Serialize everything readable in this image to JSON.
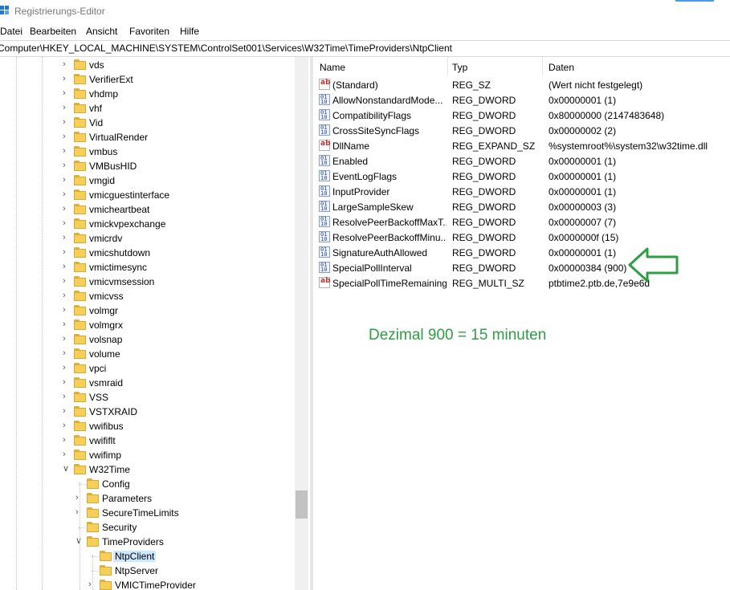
{
  "window": {
    "title": "Registrierungs-Editor"
  },
  "menu": [
    "Datei",
    "Bearbeiten",
    "Ansicht",
    "Favoriten",
    "Hilfe"
  ],
  "address": "Computer\\HKEY_LOCAL_MACHINE\\SYSTEM\\ControlSet001\\Services\\W32Time\\TimeProviders\\NtpClient",
  "tree": [
    {
      "label": "vds"
    },
    {
      "label": "VerifierExt"
    },
    {
      "label": "vhdmp"
    },
    {
      "label": "vhf"
    },
    {
      "label": "Vid"
    },
    {
      "label": "VirtualRender"
    },
    {
      "label": "vmbus"
    },
    {
      "label": "VMBusHID"
    },
    {
      "label": "vmgid"
    },
    {
      "label": "vmicguestinterface"
    },
    {
      "label": "vmicheartbeat"
    },
    {
      "label": "vmickvpexchange"
    },
    {
      "label": "vmicrdv"
    },
    {
      "label": "vmicshutdown"
    },
    {
      "label": "vmictimesync"
    },
    {
      "label": "vmicvmsession"
    },
    {
      "label": "vmicvss"
    },
    {
      "label": "volmgr"
    },
    {
      "label": "volmgrx"
    },
    {
      "label": "volsnap"
    },
    {
      "label": "volume"
    },
    {
      "label": "vpci"
    },
    {
      "label": "vsmraid"
    },
    {
      "label": "VSS"
    },
    {
      "label": "VSTXRAID"
    },
    {
      "label": "vwifibus"
    },
    {
      "label": "vwififlt"
    },
    {
      "label": "vwifimp"
    },
    {
      "label": "W32Time"
    },
    {
      "label": "Config"
    },
    {
      "label": "Parameters"
    },
    {
      "label": "SecureTimeLimits"
    },
    {
      "label": "Security"
    },
    {
      "label": "TimeProviders"
    },
    {
      "label": "NtpClient"
    },
    {
      "label": "NtpServer"
    },
    {
      "label": "VMICTimeProvider"
    }
  ],
  "list": {
    "headers": {
      "name": "Name",
      "type": "Typ",
      "data": "Daten"
    },
    "rows": [
      {
        "name": "(Standard)",
        "type": "REG_SZ",
        "data": "(Wert nicht festgelegt)",
        "icon": "string"
      },
      {
        "name": "AllowNonstandardMode...",
        "type": "REG_DWORD",
        "data": "0x00000001 (1)",
        "icon": "binary"
      },
      {
        "name": "CompatibilityFlags",
        "type": "REG_DWORD",
        "data": "0x80000000 (2147483648)",
        "icon": "binary"
      },
      {
        "name": "CrossSiteSyncFlags",
        "type": "REG_DWORD",
        "data": "0x00000002 (2)",
        "icon": "binary"
      },
      {
        "name": "DllName",
        "type": "REG_EXPAND_SZ",
        "data": "%systemroot%\\system32\\w32time.dll",
        "icon": "string"
      },
      {
        "name": "Enabled",
        "type": "REG_DWORD",
        "data": "0x00000001 (1)",
        "icon": "binary"
      },
      {
        "name": "EventLogFlags",
        "type": "REG_DWORD",
        "data": "0x00000001 (1)",
        "icon": "binary"
      },
      {
        "name": "InputProvider",
        "type": "REG_DWORD",
        "data": "0x00000001 (1)",
        "icon": "binary"
      },
      {
        "name": "LargeSampleSkew",
        "type": "REG_DWORD",
        "data": "0x00000003 (3)",
        "icon": "binary"
      },
      {
        "name": "ResolvePeerBackoffMaxT...",
        "type": "REG_DWORD",
        "data": "0x00000007 (7)",
        "icon": "binary"
      },
      {
        "name": "ResolvePeerBackoffMinu...",
        "type": "REG_DWORD",
        "data": "0x0000000f (15)",
        "icon": "binary"
      },
      {
        "name": "SignatureAuthAllowed",
        "type": "REG_DWORD",
        "data": "0x00000001 (1)",
        "icon": "binary"
      },
      {
        "name": "SpecialPollInterval",
        "type": "REG_DWORD",
        "data": "0x00000384 (900)",
        "icon": "binary"
      },
      {
        "name": "SpecialPollTimeRemaining",
        "type": "REG_MULTI_SZ",
        "data": "ptbtime2.ptb.de,7e9e6d",
        "icon": "string"
      }
    ]
  },
  "annotation": {
    "text": "Dezimal 900 = 15 minuten",
    "color": "#2e9e45"
  },
  "colors": {
    "accent": "#1f7ad6",
    "selection": "#cce8ff",
    "folder": "#f5cf58",
    "annotation": "#2e9e45"
  },
  "icons": {
    "string": "string-value-icon",
    "binary": "binary-value-icon",
    "folder": "folder-icon",
    "arrow": "arrow-left-icon"
  }
}
